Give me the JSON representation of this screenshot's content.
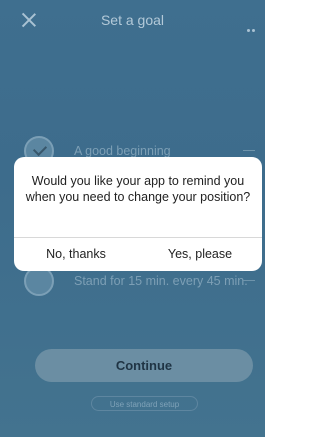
{
  "header": {
    "title": "Set a goal"
  },
  "options": [
    {
      "label": "A good beginning"
    },
    {
      "label": "Stand for 15 min. every 45 min."
    }
  ],
  "dialog": {
    "message": "Would you like your app to remind you when you need to change your position?",
    "no_label": "No, thanks",
    "yes_label": "Yes, please"
  },
  "footer": {
    "continue_label": "Continue",
    "standard_label": "Use standard setup"
  },
  "colors": {
    "background": "#3f6f8f",
    "dialog": "#ffffff",
    "button": "#6b8ea3"
  },
  "icons": [
    "close-icon",
    "more-icon",
    "check-icon",
    "arrow-icon"
  ]
}
